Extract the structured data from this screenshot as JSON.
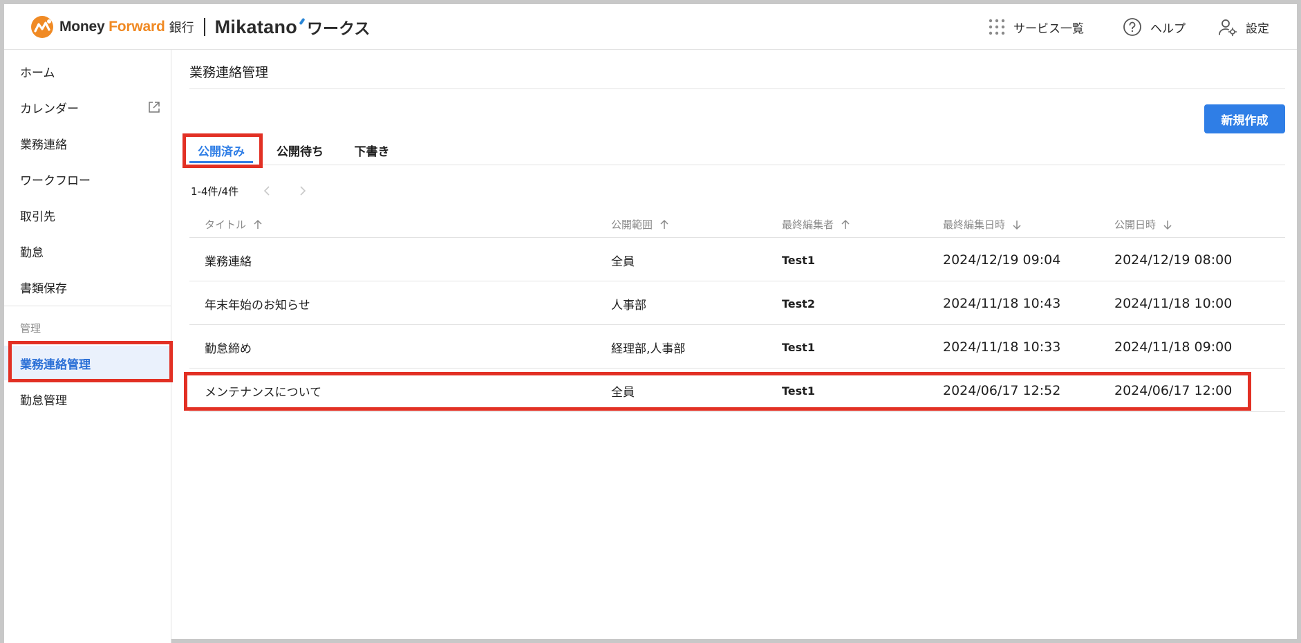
{
  "header": {
    "brand_money": "Money ",
    "brand_forward": "Forward",
    "brand_bank": "銀行",
    "brand_product": "Mikatano",
    "brand_works": "ワークス",
    "nav": [
      {
        "label": "サービス一覧",
        "icon": "grid-icon"
      },
      {
        "label": "ヘルプ",
        "icon": "help-icon"
      },
      {
        "label": "設定",
        "icon": "user-settings-icon"
      }
    ]
  },
  "sidebar": {
    "items": [
      {
        "label": "ホーム"
      },
      {
        "label": "カレンダー",
        "icon": "external-link-icon"
      },
      {
        "label": "業務連絡"
      },
      {
        "label": "ワークフロー"
      },
      {
        "label": "取引先"
      },
      {
        "label": "勤怠"
      },
      {
        "label": "書類保存"
      }
    ],
    "section_label": "管理",
    "admin_items": [
      {
        "label": "業務連絡管理",
        "active": true
      },
      {
        "label": "勤怠管理"
      }
    ]
  },
  "main": {
    "title": "業務連絡管理",
    "new_button": "新規作成",
    "tabs": [
      {
        "label": "公開済み",
        "active": true
      },
      {
        "label": "公開待ち"
      },
      {
        "label": "下書き"
      }
    ],
    "pagination": "1-4件/4件",
    "columns": [
      {
        "label": "タイトル",
        "sort": "asc"
      },
      {
        "label": "公開範囲",
        "sort": "asc"
      },
      {
        "label": "最終編集者",
        "sort": "asc"
      },
      {
        "label": "最終編集日時",
        "sort": "desc"
      },
      {
        "label": "公開日時",
        "sort": "desc"
      }
    ],
    "rows": [
      {
        "title": "業務連絡",
        "scope": "全員",
        "editor": "Test1",
        "edited_at": "2024/12/19 09:04",
        "published_at": "2024/12/19 08:00"
      },
      {
        "title": "年末年始のお知らせ",
        "scope": "人事部",
        "editor": "Test2",
        "edited_at": "2024/11/18 10:43",
        "published_at": "2024/11/18 10:00"
      },
      {
        "title": "勤怠締め",
        "scope": "経理部,人事部",
        "editor": "Test1",
        "edited_at": "2024/11/18 10:33",
        "published_at": "2024/11/18 09:00"
      },
      {
        "title": "メンテナンスについて",
        "scope": "全員",
        "editor": "Test1",
        "edited_at": "2024/06/17 12:52",
        "published_at": "2024/06/17 12:00"
      }
    ]
  },
  "colors": {
    "accent": "#2f7ee6",
    "highlight": "#e23024",
    "brand_orange": "#f08a24"
  }
}
